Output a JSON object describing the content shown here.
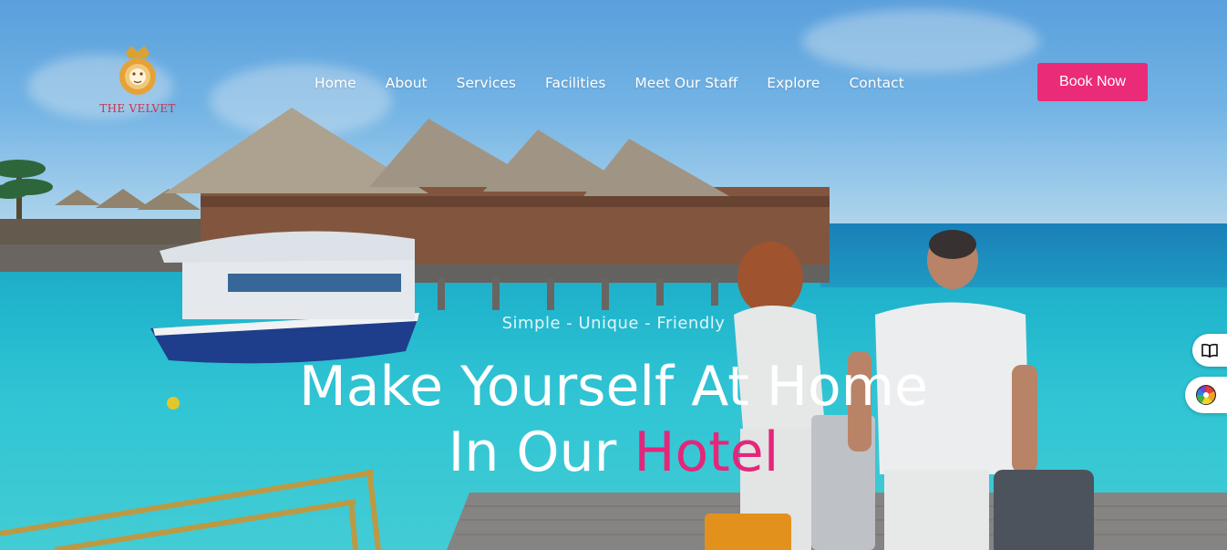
{
  "brand": {
    "name": "THE VELVET"
  },
  "nav": {
    "items": [
      {
        "label": "Home"
      },
      {
        "label": "About"
      },
      {
        "label": "Services"
      },
      {
        "label": "Facilities"
      },
      {
        "label": "Meet Our Staff"
      },
      {
        "label": "Explore"
      },
      {
        "label": "Contact"
      }
    ]
  },
  "header": {
    "cta_label": "Book Now"
  },
  "hero": {
    "tagline": "Simple - Unique - Friendly",
    "line1": "Make Yourself At Home",
    "line2_prefix": "In Our ",
    "line2_accent": "Hotel"
  },
  "side_widgets": {
    "guide_icon": "book-open-icon",
    "theme_icon": "color-wheel-icon"
  },
  "colors": {
    "accent": "#e5267a",
    "button": "#ea2b77",
    "logo_gold": "#d9a233",
    "logo_text": "#c8324b"
  }
}
